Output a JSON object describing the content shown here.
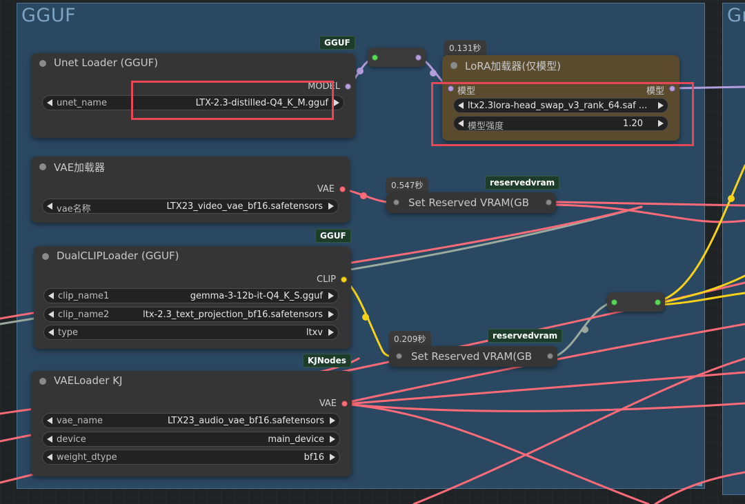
{
  "groups": {
    "main_title": "GGUF",
    "right_title": "Gr"
  },
  "colors": {
    "model_wire": "#b39ddb",
    "vae_wire": "#ff6b78",
    "clip_wire": "#f7d21b",
    "gray_wire": "#9aaa9e",
    "group_bg": "#2b4862",
    "lora_node_bg": "#5a4b2f"
  },
  "nodes": {
    "unet_loader": {
      "tag": "GGUF",
      "title": "Unet Loader (GGUF)",
      "output": "MODEL",
      "widgets": [
        {
          "name": "unet_name",
          "value": "LTX-2.3-distilled-Q4_K_M.gguf"
        }
      ]
    },
    "lora_loader": {
      "timing": "0.131秒",
      "title": "LoRA加载器(仅模型)",
      "input": "模型",
      "output": "模型",
      "widgets": [
        {
          "name": "",
          "value": "ltx2.3lora-head_swap_v3_rank_64.saf ..."
        },
        {
          "name": "模型强度",
          "value": "1.20"
        }
      ]
    },
    "vae_loader": {
      "title": "VAE加载器",
      "output": "VAE",
      "widgets": [
        {
          "name": "vae名称",
          "value": "LTX23_video_vae_bf16.safetensors"
        }
      ]
    },
    "set_vram_1": {
      "timing": "0.547秒",
      "tag": "reservedvram",
      "title": "Set Reserved VRAM(GB"
    },
    "dual_clip_loader": {
      "tag": "GGUF",
      "title": "DualCLIPLoader (GGUF)",
      "output": "CLIP",
      "widgets": [
        {
          "name": "clip_name1",
          "value": "gemma-3-12b-it-Q4_K_S.gguf"
        },
        {
          "name": "clip_name2",
          "value": "ltx-2.3_text_projection_bf16.safetensors"
        },
        {
          "name": "type",
          "value": "ltxv"
        }
      ]
    },
    "set_vram_2": {
      "timing": "0.209秒",
      "tag": "reservedvram",
      "title": "Set Reserved VRAM(GB"
    },
    "vae_loader_kj": {
      "tag": "KJNodes",
      "title": "VAELoader KJ",
      "output": "VAE",
      "widgets": [
        {
          "name": "vae_name",
          "value": "LTX23_audio_vae_bf16.safetensors"
        },
        {
          "name": "device",
          "value": "main_device"
        },
        {
          "name": "weight_dtype",
          "value": "bf16"
        }
      ]
    }
  }
}
